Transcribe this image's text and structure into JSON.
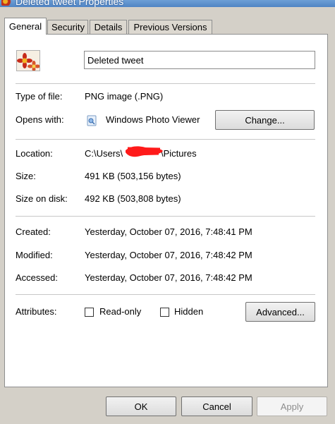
{
  "window": {
    "title": "Deleted tweet Properties"
  },
  "tabs": [
    {
      "label": "General",
      "active": true
    },
    {
      "label": "Security",
      "active": false
    },
    {
      "label": "Details",
      "active": false
    },
    {
      "label": "Previous Versions",
      "active": false
    }
  ],
  "file": {
    "name_value": "Deleted tweet",
    "icon": "image-file-icon"
  },
  "info": {
    "type_label": "Type of file:",
    "type_value": "PNG image (.PNG)",
    "opens_label": "Opens with:",
    "opens_value": "Windows Photo Viewer",
    "opens_icon": "photo-viewer-icon",
    "change_button": "Change...",
    "location_label": "Location:",
    "location_prefix": "C:\\Users\\",
    "location_suffix": "\\Pictures",
    "size_label": "Size:",
    "size_value": "491 KB (503,156 bytes)",
    "size_on_disk_label": "Size on disk:",
    "size_on_disk_value": "492 KB (503,808 bytes)",
    "created_label": "Created:",
    "created_value": "Yesterday, October 07, 2016, 7:48:41 PM",
    "modified_label": "Modified:",
    "modified_value": "Yesterday, October 07, 2016, 7:48:42 PM",
    "accessed_label": "Accessed:",
    "accessed_value": "Yesterday, October 07, 2016, 7:48:42 PM",
    "attributes_label": "Attributes:",
    "readonly_label": "Read-only",
    "readonly_checked": false,
    "hidden_label": "Hidden",
    "hidden_checked": false,
    "advanced_button": "Advanced..."
  },
  "footer": {
    "ok": "OK",
    "cancel": "Cancel",
    "apply": "Apply"
  },
  "colors": {
    "dialog_bg": "#d4d0c8",
    "panel_bg": "#ffffff",
    "redaction": "#ff1a1a"
  }
}
